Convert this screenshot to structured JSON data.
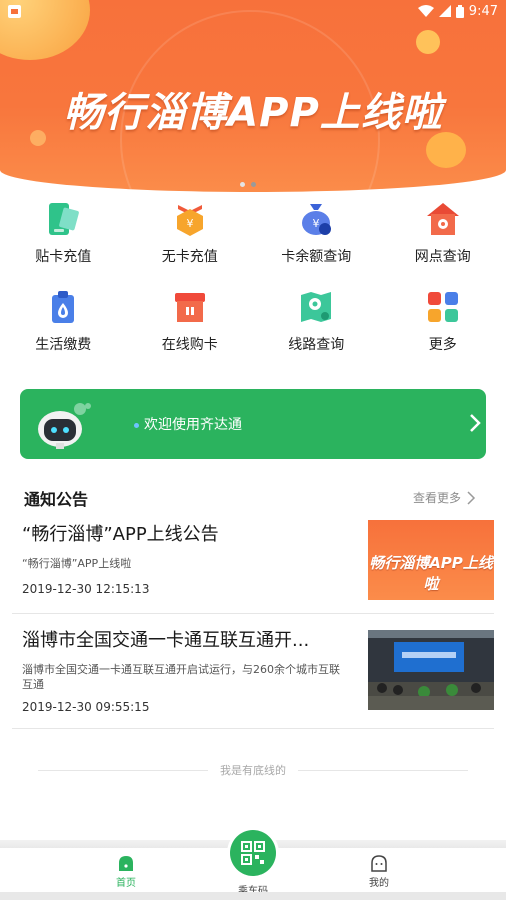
{
  "status_bar": {
    "time": "9:47"
  },
  "banner": {
    "title": "畅行淄博APP上线啦",
    "slide_count": 2,
    "active_slide": 2
  },
  "services": [
    {
      "label": "贴卡充值",
      "icon": "card-recharge-icon"
    },
    {
      "label": "无卡充值",
      "icon": "no-card-recharge-icon"
    },
    {
      "label": "卡余额查询",
      "icon": "balance-query-icon"
    },
    {
      "label": "网点查询",
      "icon": "outlet-query-icon"
    },
    {
      "label": "生活缴费",
      "icon": "bill-payment-icon"
    },
    {
      "label": "在线购卡",
      "icon": "buy-card-icon"
    },
    {
      "label": "线路查询",
      "icon": "route-query-icon"
    },
    {
      "label": "更多",
      "icon": "more-icon"
    }
  ],
  "welcome": {
    "text": "欢迎使用齐达通"
  },
  "notices": {
    "title": "通知公告",
    "more": "查看更多",
    "items": [
      {
        "title": "“畅行淄博”APP上线公告",
        "subtitle": "“畅行淄博”APP上线啦",
        "date": "2019-12-30 12:15:13",
        "thumb_text": "畅行淄博APP上线啦"
      },
      {
        "title": "淄博市全国交通一卡通互联互通开...",
        "subtitle": "淄博市全国交通一卡通互联互通开启试运行，与260余个城市互联互通",
        "date": "2019-12-30 09:55:15",
        "thumb_text": ""
      }
    ]
  },
  "footer": {
    "end_text": "我是有底线的"
  },
  "tabbar": {
    "home": "首页",
    "ride_code": "乘车码",
    "mine": "我的"
  },
  "colors": {
    "brand_green": "#2bb35e",
    "banner_orange": "#f7713b"
  }
}
